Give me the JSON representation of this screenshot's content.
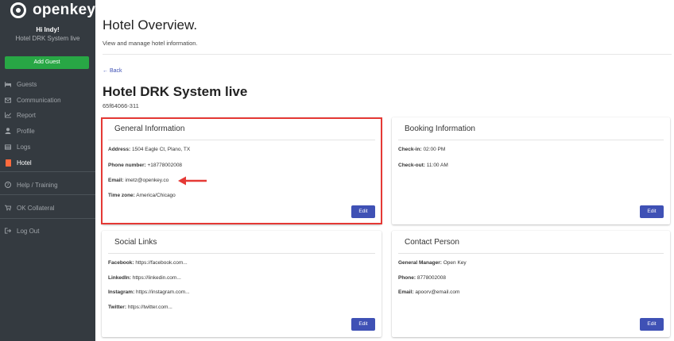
{
  "sidebar": {
    "brand": "openkey",
    "greeting": "Hi Indy!",
    "hotel_name": "Hotel DRK System live",
    "add_guest_label": "Add Guest",
    "items": [
      {
        "label": "Guests",
        "icon": "bed-icon"
      },
      {
        "label": "Communication",
        "icon": "envelope-icon"
      },
      {
        "label": "Report",
        "icon": "chart-icon"
      },
      {
        "label": "Profile",
        "icon": "user-icon"
      },
      {
        "label": "Logs",
        "icon": "list-icon"
      },
      {
        "label": "Hotel",
        "icon": "building-icon"
      },
      {
        "label": "Help / Training",
        "icon": "help-icon"
      },
      {
        "label": "OK Collateral",
        "icon": "cart-icon"
      },
      {
        "label": "Log Out",
        "icon": "logout-icon"
      }
    ],
    "active_item": "Hotel",
    "accent_color": "#ff6a3d",
    "add_guest_color": "#28a745"
  },
  "header": {
    "title": "Hotel Overview.",
    "subtitle": "View and manage hotel information."
  },
  "back_label": "Back",
  "hotel": {
    "name": "Hotel DRK System live",
    "id": "65f64066-311"
  },
  "cards": {
    "general": {
      "title": "General Information",
      "address_label": "Address:",
      "address": "1504 Eagle Ct, Plano, TX",
      "phone_label": "Phone number:",
      "phone": "+18778002008",
      "email_label": "Email:",
      "email": "imetz@openkey.co",
      "timezone_label": "Time zone:",
      "timezone": "America/Chicago",
      "edit_label": "Edit"
    },
    "booking": {
      "title": "Booking Information",
      "checkin_label": "Check-in:",
      "checkin": "02:00 PM",
      "checkout_label": "Check-out:",
      "checkout": "11:00 AM",
      "edit_label": "Edit"
    },
    "social": {
      "title": "Social Links",
      "facebook_label": "Facebook:",
      "facebook": "https://facebook.com...",
      "linkedin_label": "LinkedIn:",
      "linkedin": "https://linkedin.com...",
      "instagram_label": "Instagram:",
      "instagram": "https://instagram.com...",
      "twitter_label": "Twitter:",
      "twitter": "https://twitter.com...",
      "edit_label": "Edit"
    },
    "contact": {
      "title": "Contact Person",
      "manager_label": "General Manager:",
      "manager": "Open Key",
      "phone_label": "Phone:",
      "phone": "8778002008",
      "email_label": "Email:",
      "email": "apoorv@email.com",
      "edit_label": "Edit"
    }
  },
  "colors": {
    "primary_button": "#3f51b5",
    "highlight": "#e53935",
    "sidebar_bg": "#343a40"
  }
}
